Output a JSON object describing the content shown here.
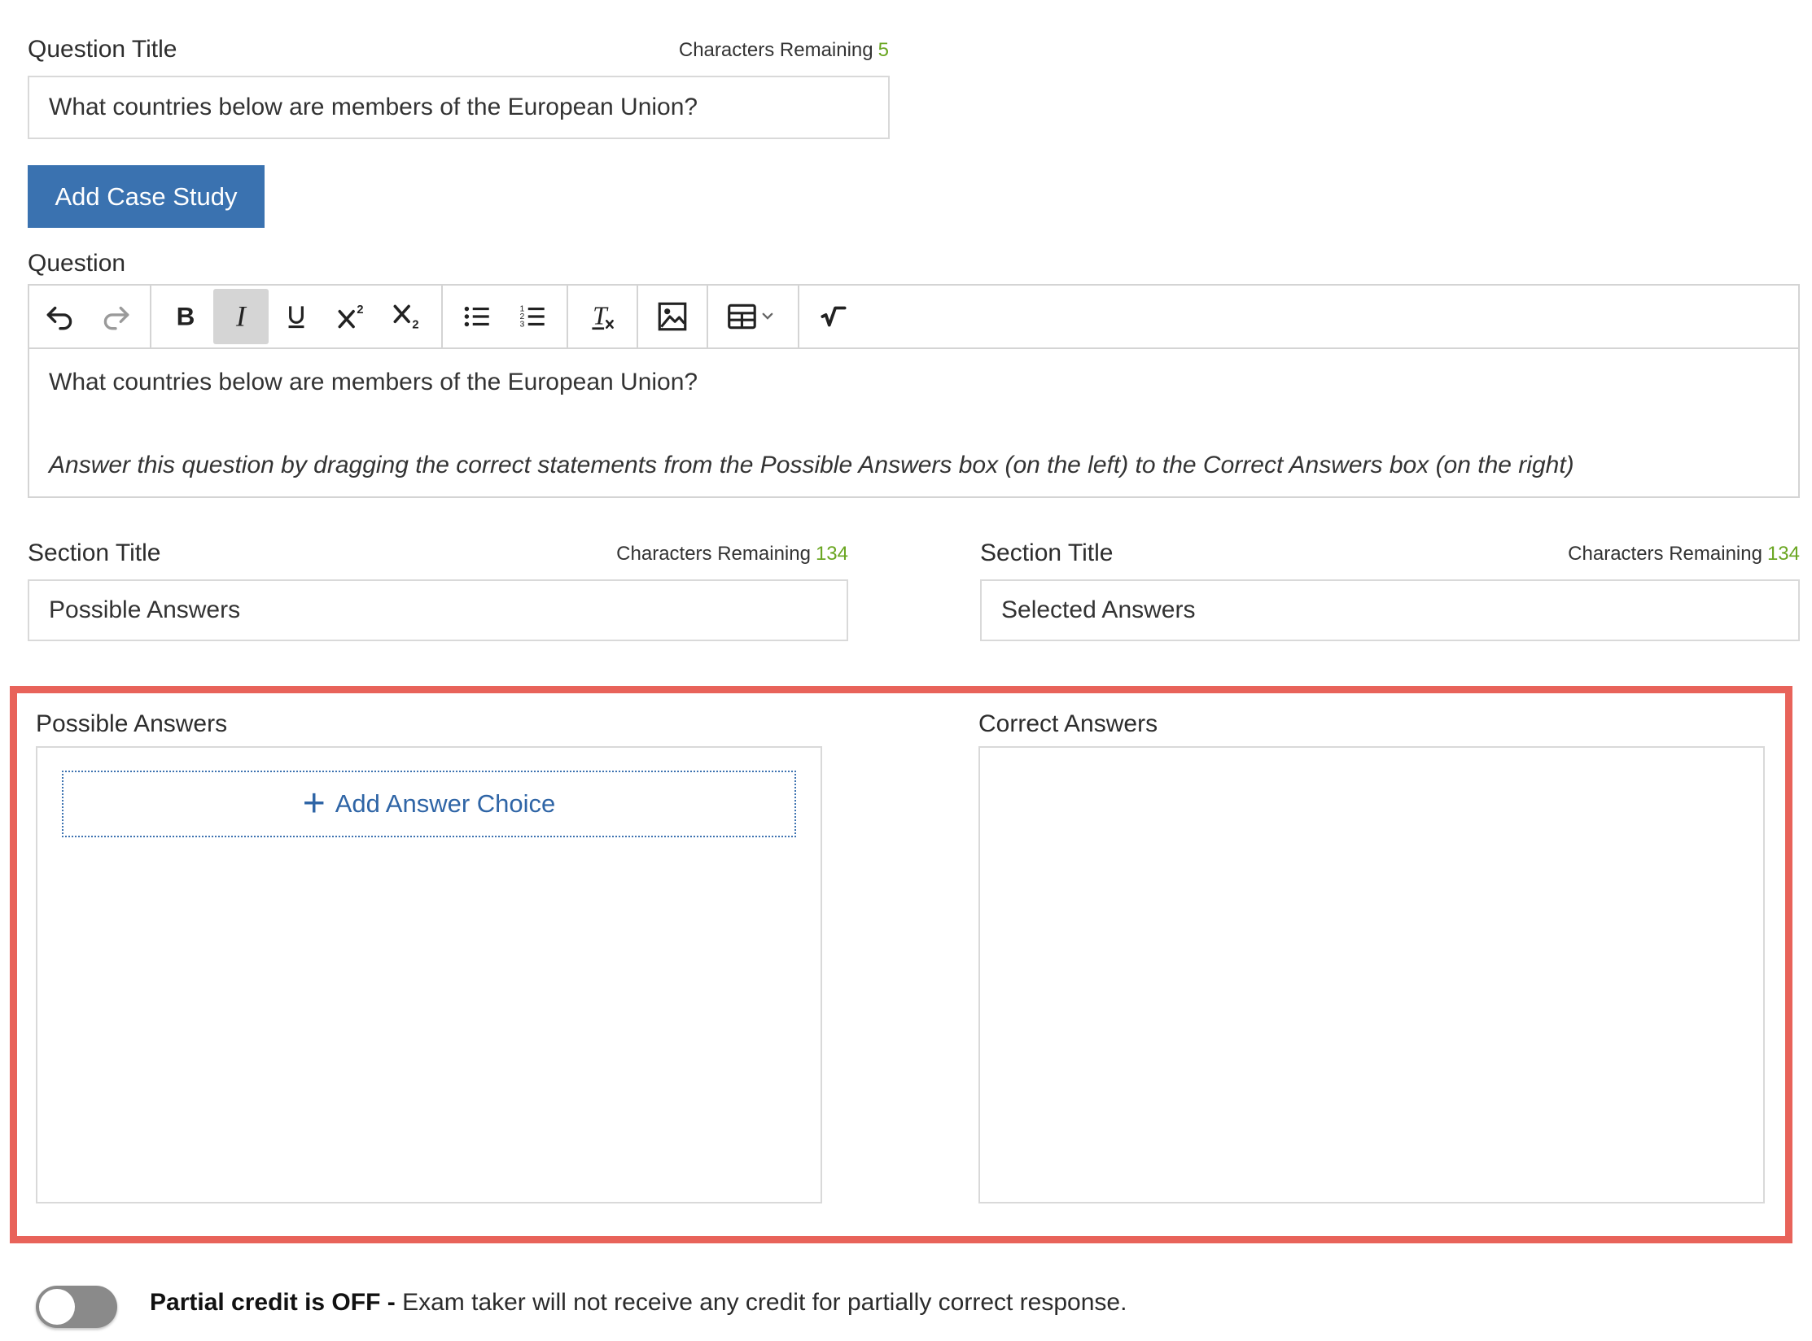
{
  "question_title": {
    "label": "Question Title",
    "counter_label": "Characters Remaining",
    "counter_value": "5",
    "value": "What countries below are members of the European Union?"
  },
  "add_case_study_label": "Add Case Study",
  "question": {
    "label": "Question",
    "toolbar": [
      "undo-icon",
      "redo-icon",
      "bold-icon",
      "italic-icon",
      "underline-icon",
      "superscript-icon",
      "subscript-icon",
      "bulleted-list-icon",
      "numbered-list-icon",
      "clear-formatting-icon",
      "image-icon",
      "table-icon",
      "formula-icon"
    ],
    "body_line1": "What countries below are members of the European Union?",
    "body_line2": "Answer this question by dragging the correct statements from the Possible Answers box (on the left) to the Correct Answers box (on the right)"
  },
  "section_left": {
    "label": "Section Title",
    "counter_label": "Characters Remaining",
    "counter_value": "134",
    "value": "Possible Answers"
  },
  "section_right": {
    "label": "Section Title",
    "counter_label": "Characters Remaining",
    "counter_value": "134",
    "value": "Selected Answers"
  },
  "possible_answers": {
    "title": "Possible Answers",
    "add_choice_label": "Add Answer Choice"
  },
  "correct_answers": {
    "title": "Correct Answers"
  },
  "partial_credit": {
    "bold": "Partial credit is OFF -",
    "text": " Exam taker will not receive any credit for partially correct response.",
    "enabled": false
  },
  "colors": {
    "primary": "#3a72b0",
    "counter_green": "#6aa621",
    "highlight_border": "#e8635a",
    "toggle_off": "#8a8a8a"
  }
}
